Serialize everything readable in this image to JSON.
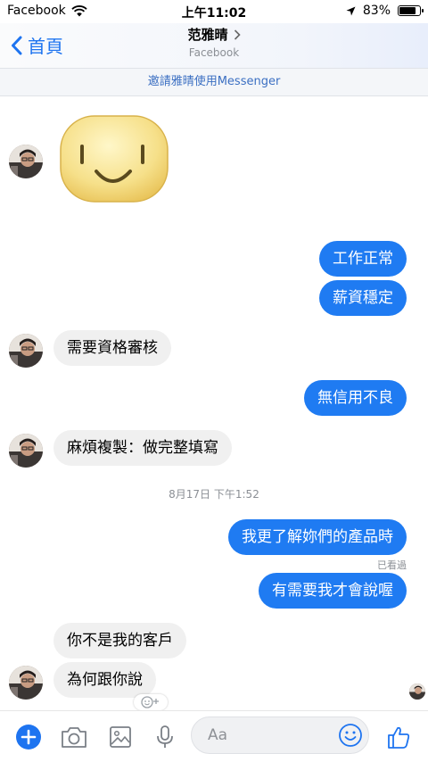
{
  "status_bar": {
    "carrier": "Facebook",
    "time": "上午11:02",
    "battery": "83%",
    "battery_level": 0.83
  },
  "header": {
    "back_label": "首頁",
    "contact_name": "范雅晴",
    "contact_subtitle": "Facebook"
  },
  "invite_banner": "邀請雅晴使用Messenger",
  "messages": [
    {
      "from": "them",
      "text": "需要資格審核"
    },
    {
      "from": "me",
      "text": "工作正常"
    },
    {
      "from": "me",
      "text": "薪資穩定"
    },
    {
      "from": "me",
      "text": "無信用不良"
    },
    {
      "from": "them",
      "text": "麻煩複製：做完整填寫"
    },
    {
      "from": "me",
      "text": "我更了解妳們的產品時"
    },
    {
      "from": "me",
      "text": "有需要我才會說喔"
    },
    {
      "from": "them",
      "text": "你不是我的客戶"
    },
    {
      "from": "them",
      "text": "為何跟你說"
    }
  ],
  "timestamp": "8月17日 下午1:52",
  "seen_label": "已看過",
  "composer": {
    "placeholder": "Aa"
  },
  "colors": {
    "accent": "#1e74f0",
    "outgoing_bubble": "#1f7bf2",
    "incoming_bubble": "#f0f0f0"
  },
  "icons": [
    "wifi-icon",
    "location-arrow-icon",
    "battery-icon",
    "back-chevron-icon",
    "chevron-right-icon",
    "plus-icon",
    "camera-icon",
    "image-icon",
    "microphone-icon",
    "emoji-icon",
    "thumbs-up-icon",
    "add-reaction-icon"
  ]
}
